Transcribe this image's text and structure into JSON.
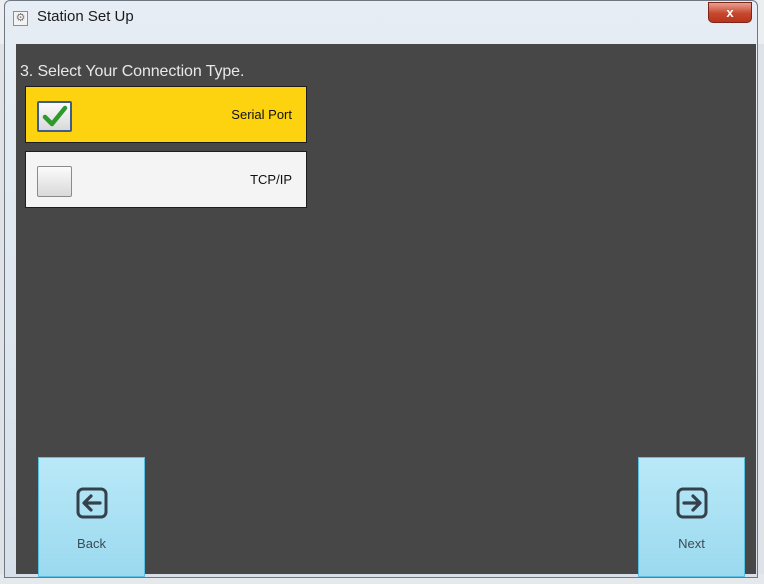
{
  "window": {
    "title": "Station Set Up",
    "close_glyph": "x"
  },
  "wizard": {
    "step_title": "3. Select Your Connection Type.",
    "options": [
      {
        "label": "Serial Port",
        "checked": true,
        "highlight_color": "#fdd30f"
      },
      {
        "label": "TCP/IP",
        "checked": false
      }
    ]
  },
  "navigation": {
    "back_label": "Back",
    "back_icon": "arrow-left-icon",
    "next_label": "Next",
    "next_icon": "arrow-right-icon"
  },
  "colors": {
    "panel": "#474747",
    "nav_button": "#a8dff2",
    "check": "#2e9a2e"
  }
}
